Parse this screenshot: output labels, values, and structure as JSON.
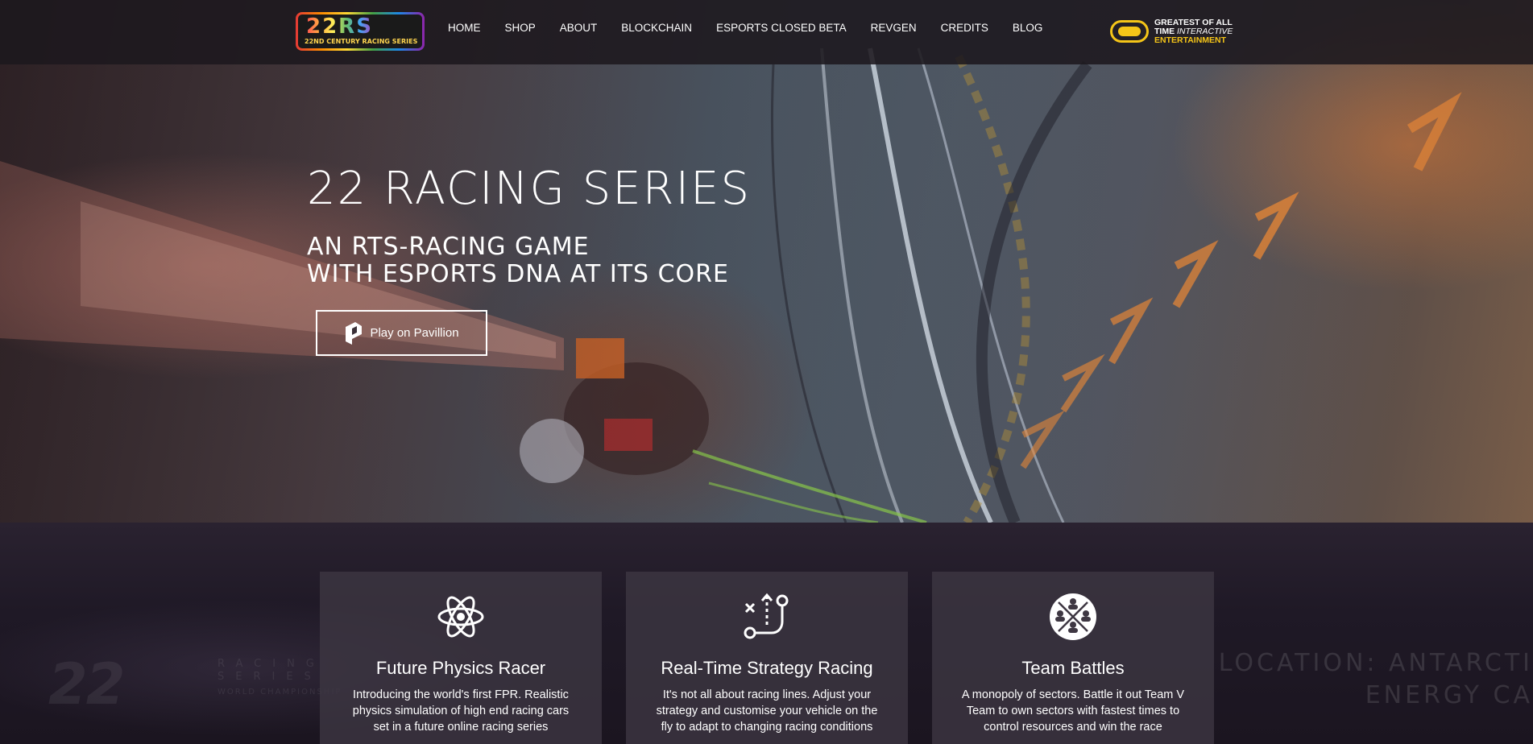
{
  "header": {
    "logo": {
      "mark": "22RS",
      "text": "22ND CENTURY RACING SERIES"
    },
    "nav": [
      {
        "label": "HOME"
      },
      {
        "label": "SHOP"
      },
      {
        "label": "ABOUT"
      },
      {
        "label": "BLOCKCHAIN"
      },
      {
        "label": "ESPORTS CLOSED BETA"
      },
      {
        "label": "REVGEN"
      },
      {
        "label": "CREDITS"
      },
      {
        "label": "BLOG"
      }
    ],
    "partner": {
      "line1": "GREATEST OF ALL",
      "line2a": "TIME ",
      "line2b": "INTERACTIVE",
      "line3": "ENTERTAINMENT",
      "icon": "goat-logo-icon"
    }
  },
  "hero": {
    "title": "22 RACING SERIES",
    "subtitle_line1": "AN RTS-RACING GAME",
    "subtitle_line2": "WITH ESPORTS DNA AT ITS CORE",
    "cta_label": "Play on Pavillion",
    "cta_icon": "pavillion-logo-icon"
  },
  "features": {
    "background_text": {
      "logo": "22",
      "racing": "RACING\nSERIES",
      "world": "WORLD CHAMPIONSHIP",
      "location_line1": "LOCATION: ANTARCTI",
      "location_line2": "ENERGY CA"
    },
    "cards": [
      {
        "icon": "atom-icon",
        "title": "Future Physics Racer",
        "text": "Introducing the world's first FPR. Realistic physics simulation of high end racing cars set in a future online racing series"
      },
      {
        "icon": "strategy-icon",
        "title": "Real-Time Strategy Racing",
        "text": "It's not all about racing lines. Adjust your strategy and customise your vehicle on the fly to adapt to changing racing conditions"
      },
      {
        "icon": "team-icon",
        "title": "Team Battles",
        "text": "A monopoly of sectors. Battle it out Team V Team to own sectors with fastest times to control resources and win the race"
      }
    ]
  },
  "colors": {
    "accent_gold": "#f5c518",
    "header_bg": "#1c181e",
    "card_bg": "#3e3742"
  }
}
